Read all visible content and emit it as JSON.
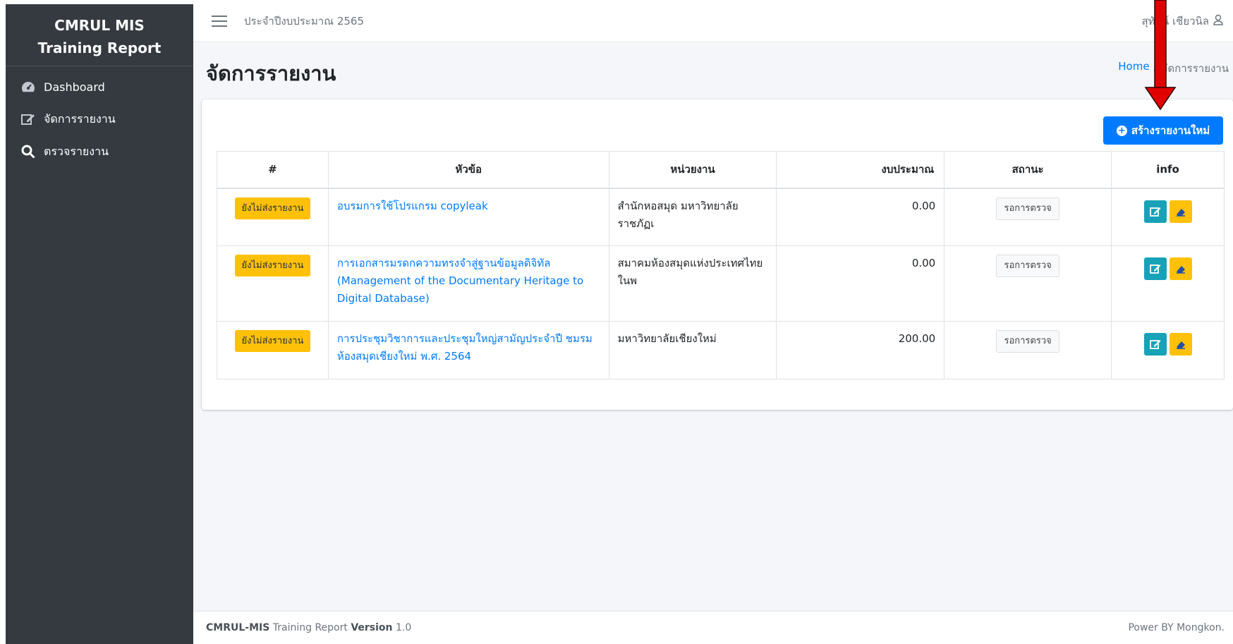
{
  "sidebar": {
    "brand_line1": "CMRUL MIS",
    "brand_line2": "Training Report",
    "items": [
      {
        "label": "Dashboard",
        "icon": "dashboard-icon"
      },
      {
        "label": "จัดการรายงาน",
        "icon": "edit-icon"
      },
      {
        "label": "ตรวจรายงาน",
        "icon": "search-icon"
      }
    ]
  },
  "topbar": {
    "fiscal_year": "ประจำปีงบประมาณ 2565",
    "user_name": "สุทัศน์ เชียวนิล"
  },
  "page": {
    "title": "จัดการรายงาน",
    "breadcrumb_home": "Home",
    "breadcrumb_sep": "/",
    "breadcrumb_current": "จัดการรายงาน",
    "new_button": "สร้างรายงานใหม่"
  },
  "table": {
    "headers": [
      "#",
      "หัวข้อ",
      "หน่วยงาน",
      "งบประมาณ",
      "สถานะ",
      "info"
    ],
    "rows": [
      {
        "badge": "ยังไม่ส่งรายงาน",
        "title": "อบรมการใช้โปรแกรม copyleak",
        "org": "สำนักหอสมุด มหาวิทยาลัยราชภัฏเ",
        "budget": "0.00",
        "status": "รอการตรวจ"
      },
      {
        "badge": "ยังไม่ส่งรายงาน",
        "title": "การเอกสารมรดกความทรงจำสู่ฐานข้อมูลดิจิทัล (Management of the Documentary Heritage to Digital Database)",
        "org": "สมาคมห้องสมุดแห่งประเทศไทย ในพ",
        "budget": "0.00",
        "status": "รอการตรวจ"
      },
      {
        "badge": "ยังไม่ส่งรายงาน",
        "title": "การประชุมวิชาการและประชุมใหญ่สามัญประจำปี ชมรมห้องสมุดเชียงใหม่ พ.ศ. 2564",
        "org": "มหาวิทยาลัยเชียงใหม่",
        "budget": "200.00",
        "status": "รอการตรวจ"
      }
    ]
  },
  "footer": {
    "brand": "CMRUL-MIS",
    "name": "Training Report",
    "version_label": "Version",
    "version": "1.0",
    "credit": "Power BY Mongkon."
  },
  "colors": {
    "primary": "#007bff",
    "sidebar": "#343a40",
    "warning": "#ffc107",
    "info": "#17a2b8",
    "annotation_arrow": "#e00000"
  }
}
